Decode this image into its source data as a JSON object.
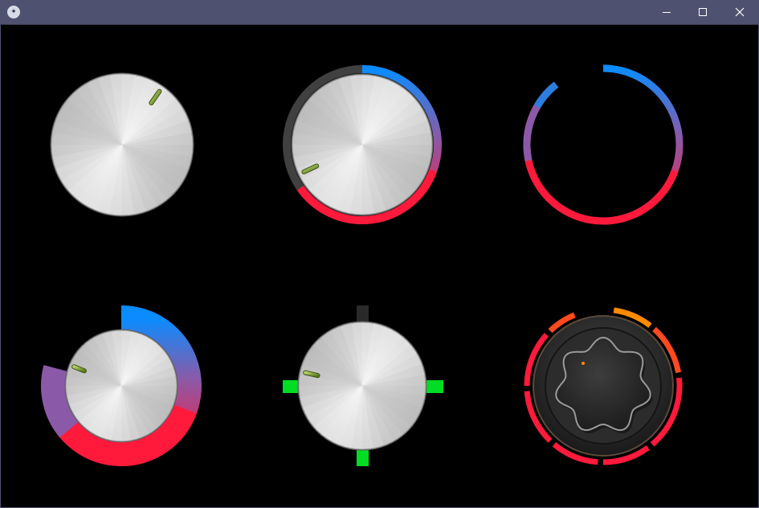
{
  "window": {
    "title": "",
    "app_icon": "kivy-logo-icon",
    "controls": [
      "minimize-icon",
      "maximize-icon",
      "close-icon"
    ]
  },
  "colors": {
    "titlebar": "#4e5270",
    "background": "#000000",
    "arc_start": "#0a8cff",
    "arc_end": "#ff1a3c",
    "track_gray": "#404040",
    "pointer_green": "#7a9a30",
    "marker_green": "#00dd22",
    "marker_gray": "#2a2a2a",
    "accent_orange": "#ff8a00"
  },
  "knobs": [
    {
      "name": "plain-knob",
      "style": "metal",
      "value_fraction": 0.1
    },
    {
      "name": "track-ring-knob",
      "style": "metal-with-track",
      "value_fraction": 0.65
    },
    {
      "name": "arc-only-ring",
      "style": "gradient-arc",
      "value_fraction": 0.95
    },
    {
      "name": "thick-arc-knob",
      "style": "metal-with-thick-arc",
      "value_fraction": 0.8
    },
    {
      "name": "marker-knob",
      "style": "metal-with-markers",
      "value_fraction": 0.8
    },
    {
      "name": "dark-segmented-knob",
      "style": "dark-segmented",
      "value_fraction": 0.9
    }
  ]
}
